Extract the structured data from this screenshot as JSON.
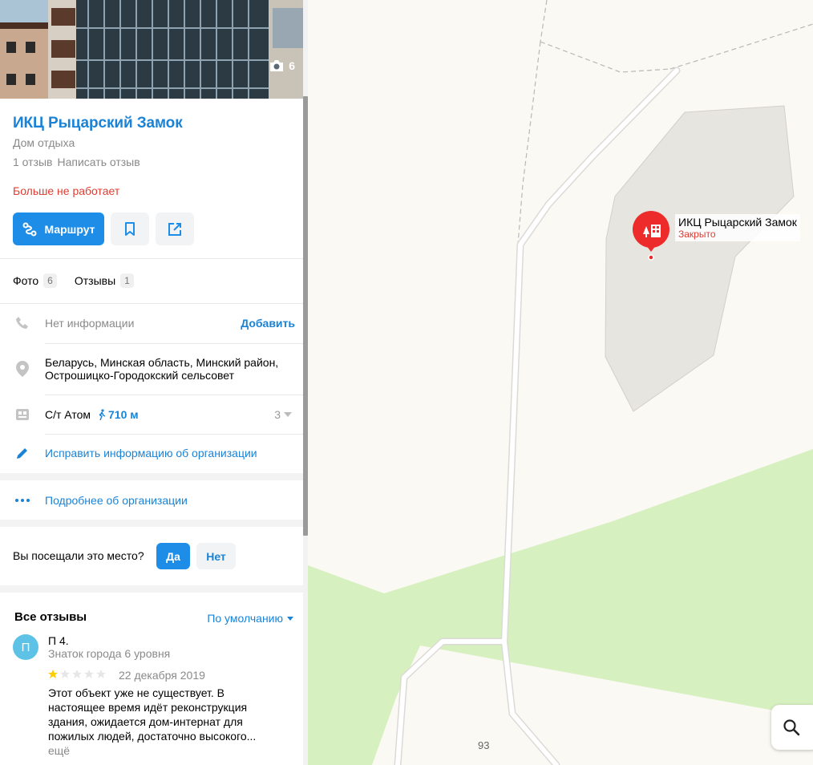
{
  "org": {
    "name": "ИКЦ Рыцарский Замок",
    "category": "Дом отдыха",
    "reviews_count_text": "1 отзыв",
    "write_review": "Написать отзыв",
    "status": "Больше не работает",
    "photo_count": "6"
  },
  "actions": {
    "route_label": "Маршрут",
    "bookmark_icon": "bookmark-icon",
    "share_icon": "share-icon"
  },
  "tabs": [
    {
      "label": "Фото",
      "count": "6"
    },
    {
      "label": "Отзывы",
      "count": "1"
    }
  ],
  "info": {
    "phone_text": "Нет информации",
    "phone_add": "Добавить",
    "address_line1": "Беларусь, Минская область, Минский район,",
    "address_line2": "Острошицко-Городокский сельсовет",
    "transit_stop": "С/т Атом",
    "transit_walk": "710 м",
    "transit_more": "3",
    "edit_link": "Исправить информацию об организации",
    "more_link": "Подробнее об организации"
  },
  "visited": {
    "question": "Вы посещали это место?",
    "yes": "Да",
    "no": "Нет"
  },
  "reviews": {
    "heading": "Все отзывы",
    "sort": "По умолчанию",
    "items": [
      {
        "avatar_letter": "П",
        "author": "П 4.",
        "level": "Знаток города 6 уровня",
        "rating": 1,
        "date": "22 декабря 2019",
        "text": "Этот объект уже не существует. В настоящее время идёт реконструкция здания, ожидается дом-интернат для пожилых людей, достаточно высокого...",
        "more": "ещё"
      }
    ]
  },
  "map": {
    "pin_name": "ИКЦ Рыцарский Замок",
    "pin_status": "Закрыто",
    "road_number": "93"
  },
  "colors": {
    "accent": "#1e8de8",
    "link": "#1a83d6",
    "closed": "#e03c31",
    "forest": "#d6f0c0",
    "land": "#fbf9f3",
    "building_area": "#e7e5e0"
  }
}
